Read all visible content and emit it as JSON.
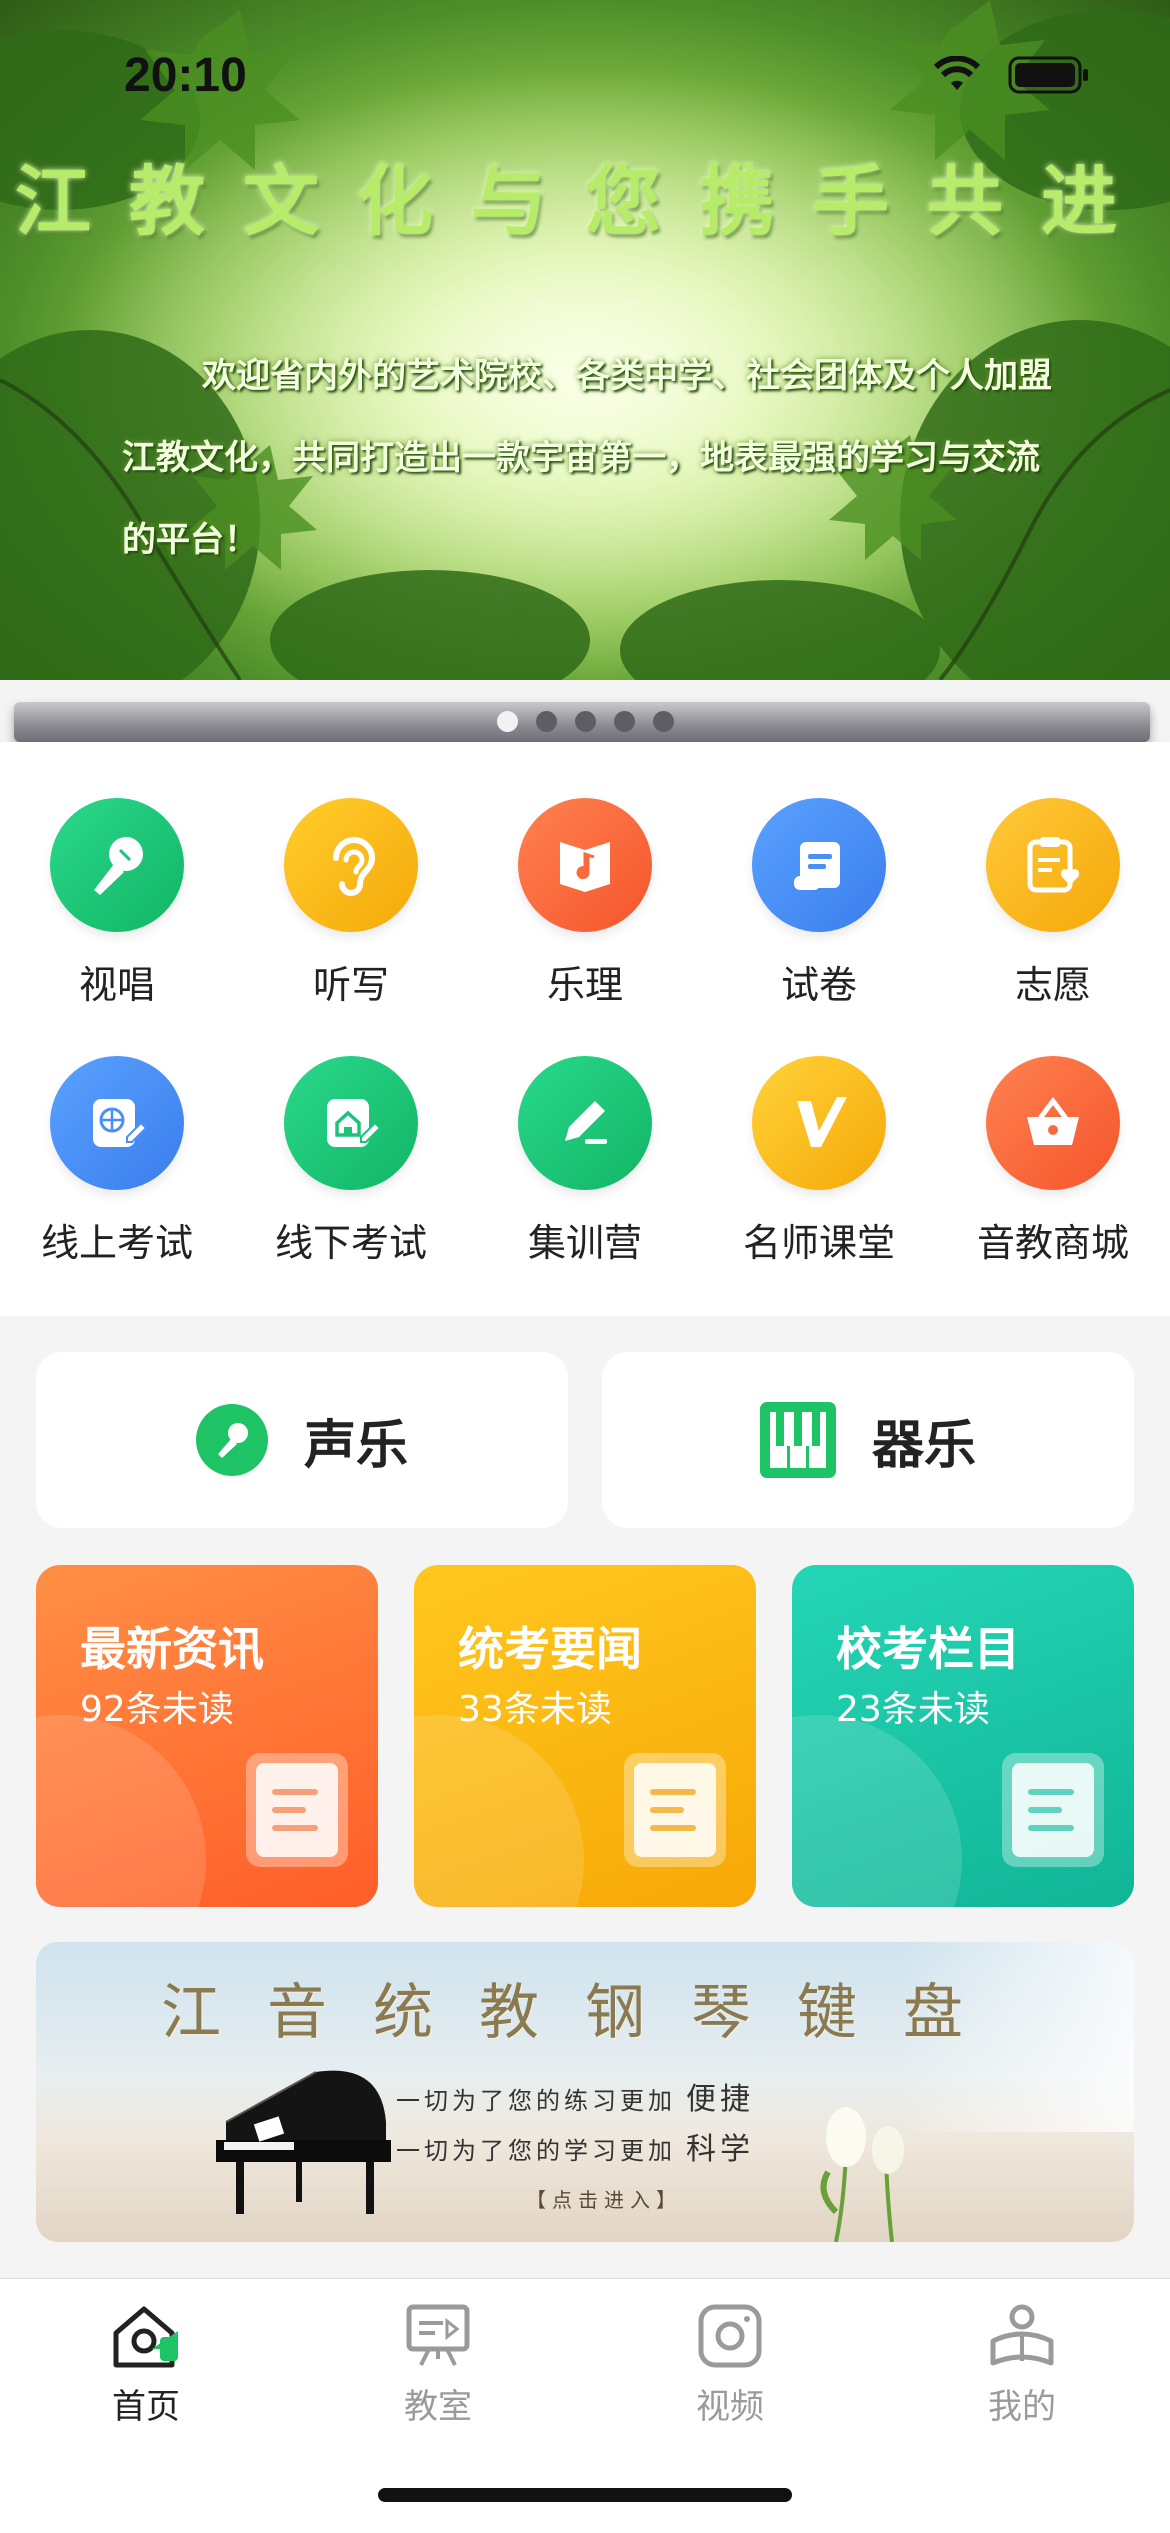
{
  "status_bar": {
    "time": "20:10"
  },
  "hero": {
    "title": "江教文化与您携手共进",
    "text": "欢迎省内外的艺术院校、各类中学、社会团体及个人加盟江教文化，共同打造出一款宇宙第一，地表最强的学习与交流的平台！",
    "page_count": 5,
    "active_page": 1
  },
  "features": [
    {
      "label": "视唱",
      "icon": "microphone-icon",
      "color": "#1dc37a"
    },
    {
      "label": "听写",
      "icon": "ear-icon",
      "color": "#f6b716"
    },
    {
      "label": "乐理",
      "icon": "music-book-icon",
      "color": "#fb6a3c"
    },
    {
      "label": "试卷",
      "icon": "scroll-icon",
      "color": "#4b8ff4"
    },
    {
      "label": "志愿",
      "icon": "clipboard-heart-icon",
      "color": "#f7b512"
    },
    {
      "label": "线上考试",
      "icon": "globe-edit-icon",
      "color": "#4b8ff4"
    },
    {
      "label": "线下考试",
      "icon": "home-edit-icon",
      "color": "#1dc37a"
    },
    {
      "label": "集训营",
      "icon": "pencil-icon",
      "color": "#1dc37a"
    },
    {
      "label": "名师课堂",
      "icon": "v-badge-icon",
      "color": "#f7b512"
    },
    {
      "label": "音教商城",
      "icon": "basket-icon",
      "color": "#fb6a3c"
    }
  ],
  "categories": {
    "vocal": {
      "label": "声乐",
      "icon": "microphone-icon",
      "color": "#1dc364"
    },
    "instrument": {
      "label": "器乐",
      "icon": "piano-keys-icon",
      "color": "#1dc364"
    }
  },
  "news": [
    {
      "title": "最新资讯",
      "count": "92条未读",
      "from": "#ff8a3c",
      "to": "#ff6a2c",
      "line": "#f6a07a"
    },
    {
      "title": "统考要闻",
      "count": "33条未读",
      "from": "#ffc51a",
      "to": "#f8ae08",
      "line": "#f5b94a"
    },
    {
      "title": "校考栏目",
      "count": "23条未读",
      "from": "#22d2b2",
      "to": "#12b89a",
      "line": "#5fd3bf"
    }
  ],
  "piano_banner": {
    "title": "江音统教钢琴键盘",
    "line1": "一切为了您的练习更加",
    "line1_em": "便捷",
    "line2": "一切为了您的学习更加",
    "line2_em": "科学",
    "enter": "【点击进入】"
  },
  "tabs": [
    {
      "label": "首页",
      "icon": "home-icon",
      "active": true
    },
    {
      "label": "教室",
      "icon": "classroom-icon",
      "active": false
    },
    {
      "label": "视频",
      "icon": "video-icon",
      "active": false
    },
    {
      "label": "我的",
      "icon": "profile-icon",
      "active": false
    }
  ],
  "colors": {
    "accent": "#1dc364",
    "tab_inactive": "#9a9a9a"
  }
}
